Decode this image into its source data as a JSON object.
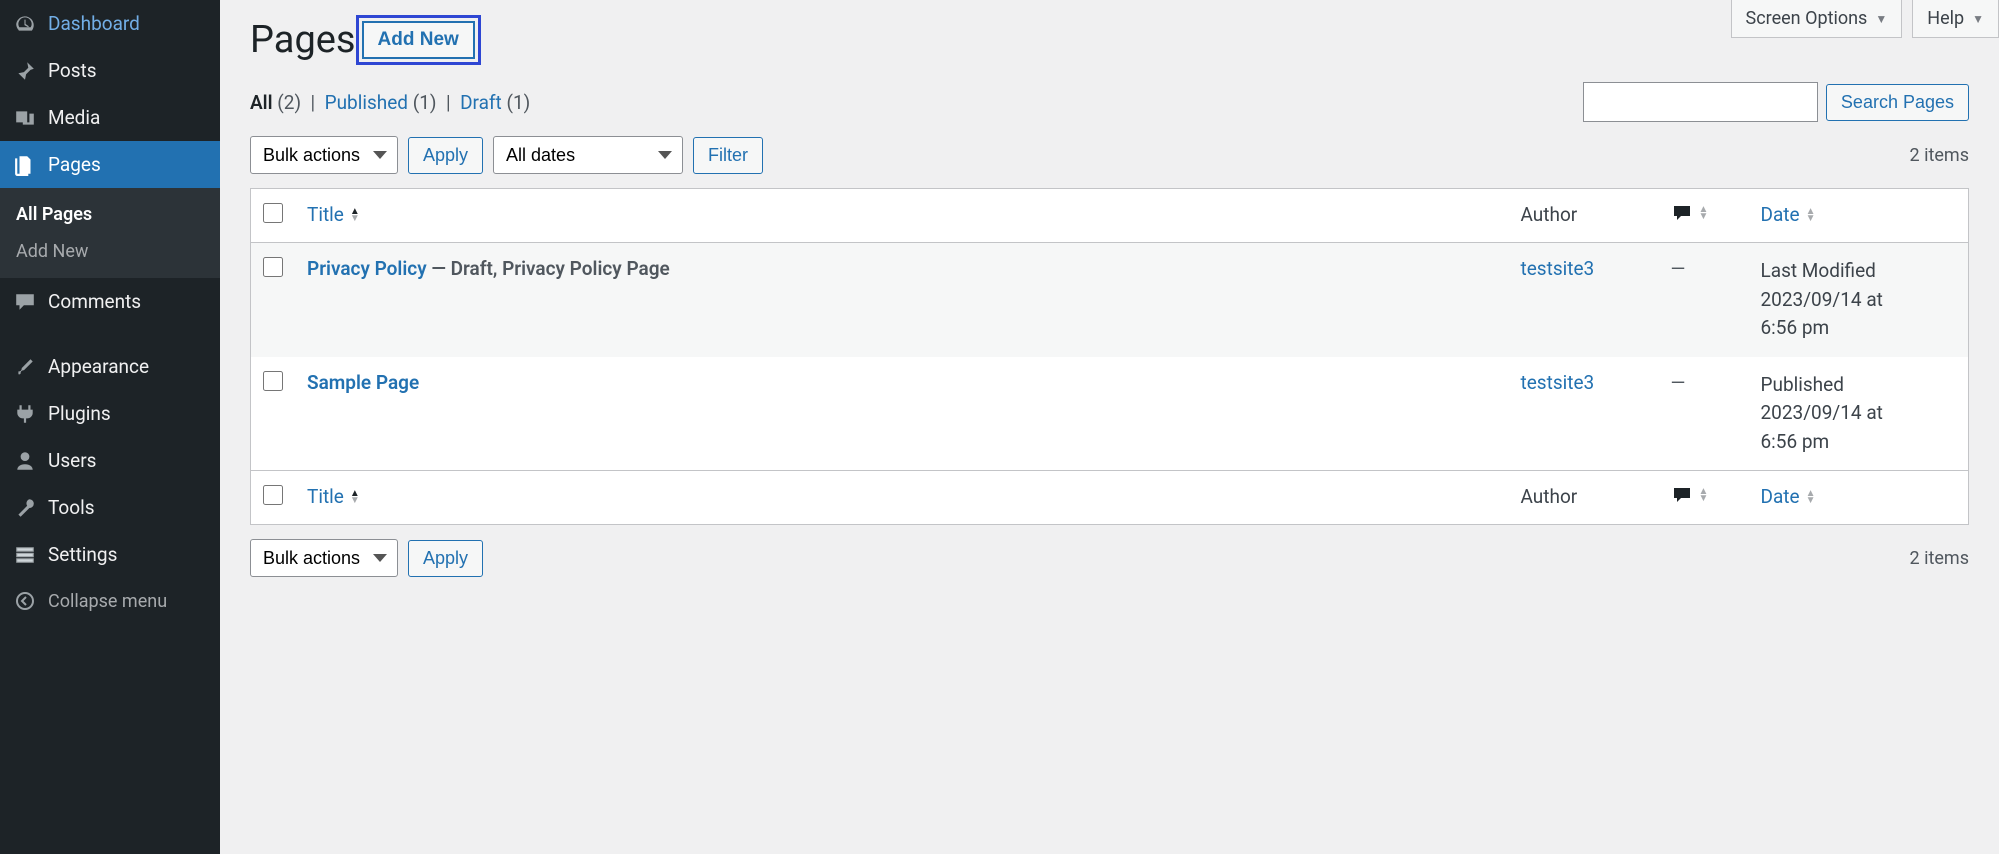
{
  "topTabs": {
    "screenOptions": "Screen Options",
    "help": "Help"
  },
  "sidebar": {
    "dashboard": "Dashboard",
    "posts": "Posts",
    "media": "Media",
    "pages": "Pages",
    "comments": "Comments",
    "appearance": "Appearance",
    "plugins": "Plugins",
    "users": "Users",
    "tools": "Tools",
    "settings": "Settings",
    "collapse": "Collapse menu",
    "sub": {
      "allPages": "All Pages",
      "addNew": "Add New"
    }
  },
  "header": {
    "title": "Pages",
    "addNew": "Add New"
  },
  "statusFilters": {
    "allLabel": "All",
    "allCount": "(2)",
    "publishedLabel": "Published",
    "publishedCount": "(1)",
    "draftLabel": "Draft",
    "draftCount": "(1)",
    "sep": "|"
  },
  "search": {
    "placeholder": "",
    "button": "Search Pages"
  },
  "actions": {
    "bulk": "Bulk actions",
    "apply": "Apply",
    "dates": "All dates",
    "filter": "Filter",
    "itemsCount": "2 items"
  },
  "columns": {
    "title": "Title",
    "author": "Author",
    "date": "Date"
  },
  "rows": [
    {
      "title": "Privacy Policy",
      "suffix": " — Draft, Privacy Policy Page",
      "author": "testsite3",
      "comments": "—",
      "dateStatus": "Last Modified",
      "dateLine2": "2023/09/14 at",
      "dateLine3": "6:56 pm"
    },
    {
      "title": "Sample Page",
      "suffix": "",
      "author": "testsite3",
      "comments": "—",
      "dateStatus": "Published",
      "dateLine2": "2023/09/14 at",
      "dateLine3": "6:56 pm"
    }
  ]
}
